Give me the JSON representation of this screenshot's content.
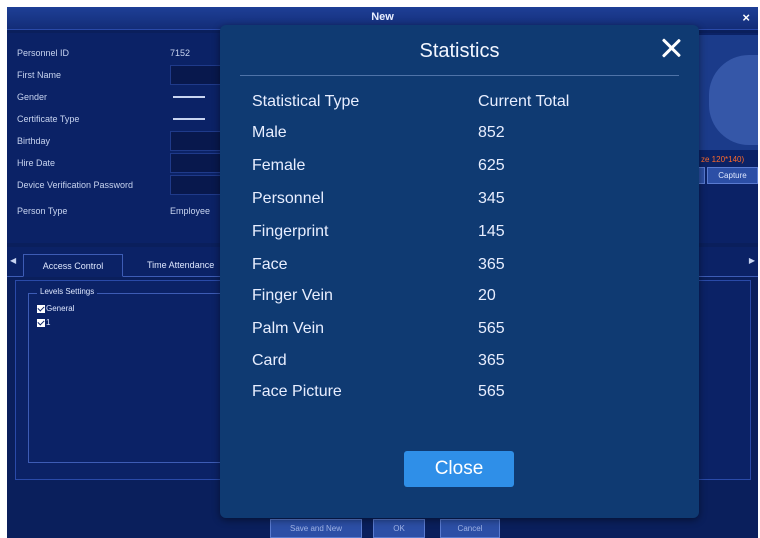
{
  "window": {
    "title": "New",
    "close_glyph": "×"
  },
  "form": {
    "fields": [
      {
        "label": "Personnel ID",
        "value": "7152"
      },
      {
        "label": "First Name",
        "value": ""
      },
      {
        "label": "Gender",
        "value": ""
      },
      {
        "label": "Certificate Type",
        "value": ""
      },
      {
        "label": "Birthday",
        "value": ""
      },
      {
        "label": "Hire Date",
        "value": ""
      },
      {
        "label": "Device Verification Password",
        "value": ""
      },
      {
        "label": "Person Type",
        "value": "Employee"
      }
    ],
    "photo_size_note": "ze 120*140)",
    "capture_label": "Capture"
  },
  "tabs": [
    {
      "label": "Access Control",
      "active": true
    },
    {
      "label": "Time Attendance",
      "active": false
    }
  ],
  "levels": {
    "title": "Levels Settings",
    "items": [
      {
        "label": "General",
        "checked": true
      },
      {
        "label": "1",
        "checked": true
      }
    ]
  },
  "bottom_buttons": [
    "Save and New",
    "OK",
    "Cancel"
  ],
  "modal": {
    "title": "Statistics",
    "header": {
      "type": "Statistical Type",
      "total": "Current Total"
    },
    "rows": [
      {
        "type": "Male",
        "total": "852"
      },
      {
        "type": "Female",
        "total": "625"
      },
      {
        "type": "Personnel",
        "total": "345"
      },
      {
        "type": "Fingerprint",
        "total": "145"
      },
      {
        "type": "Face",
        "total": "365"
      },
      {
        "type": "Finger Vein",
        "total": "20"
      },
      {
        "type": "Palm Vein",
        "total": "565"
      },
      {
        "type": "Card",
        "total": "365"
      },
      {
        "type": "Face Picture",
        "total": "565"
      }
    ],
    "close_label": "Close"
  },
  "colors": {
    "modal_bg": "#0f3a72",
    "close_button": "#2f8fe8",
    "window_bg": "#0a1f5c"
  }
}
